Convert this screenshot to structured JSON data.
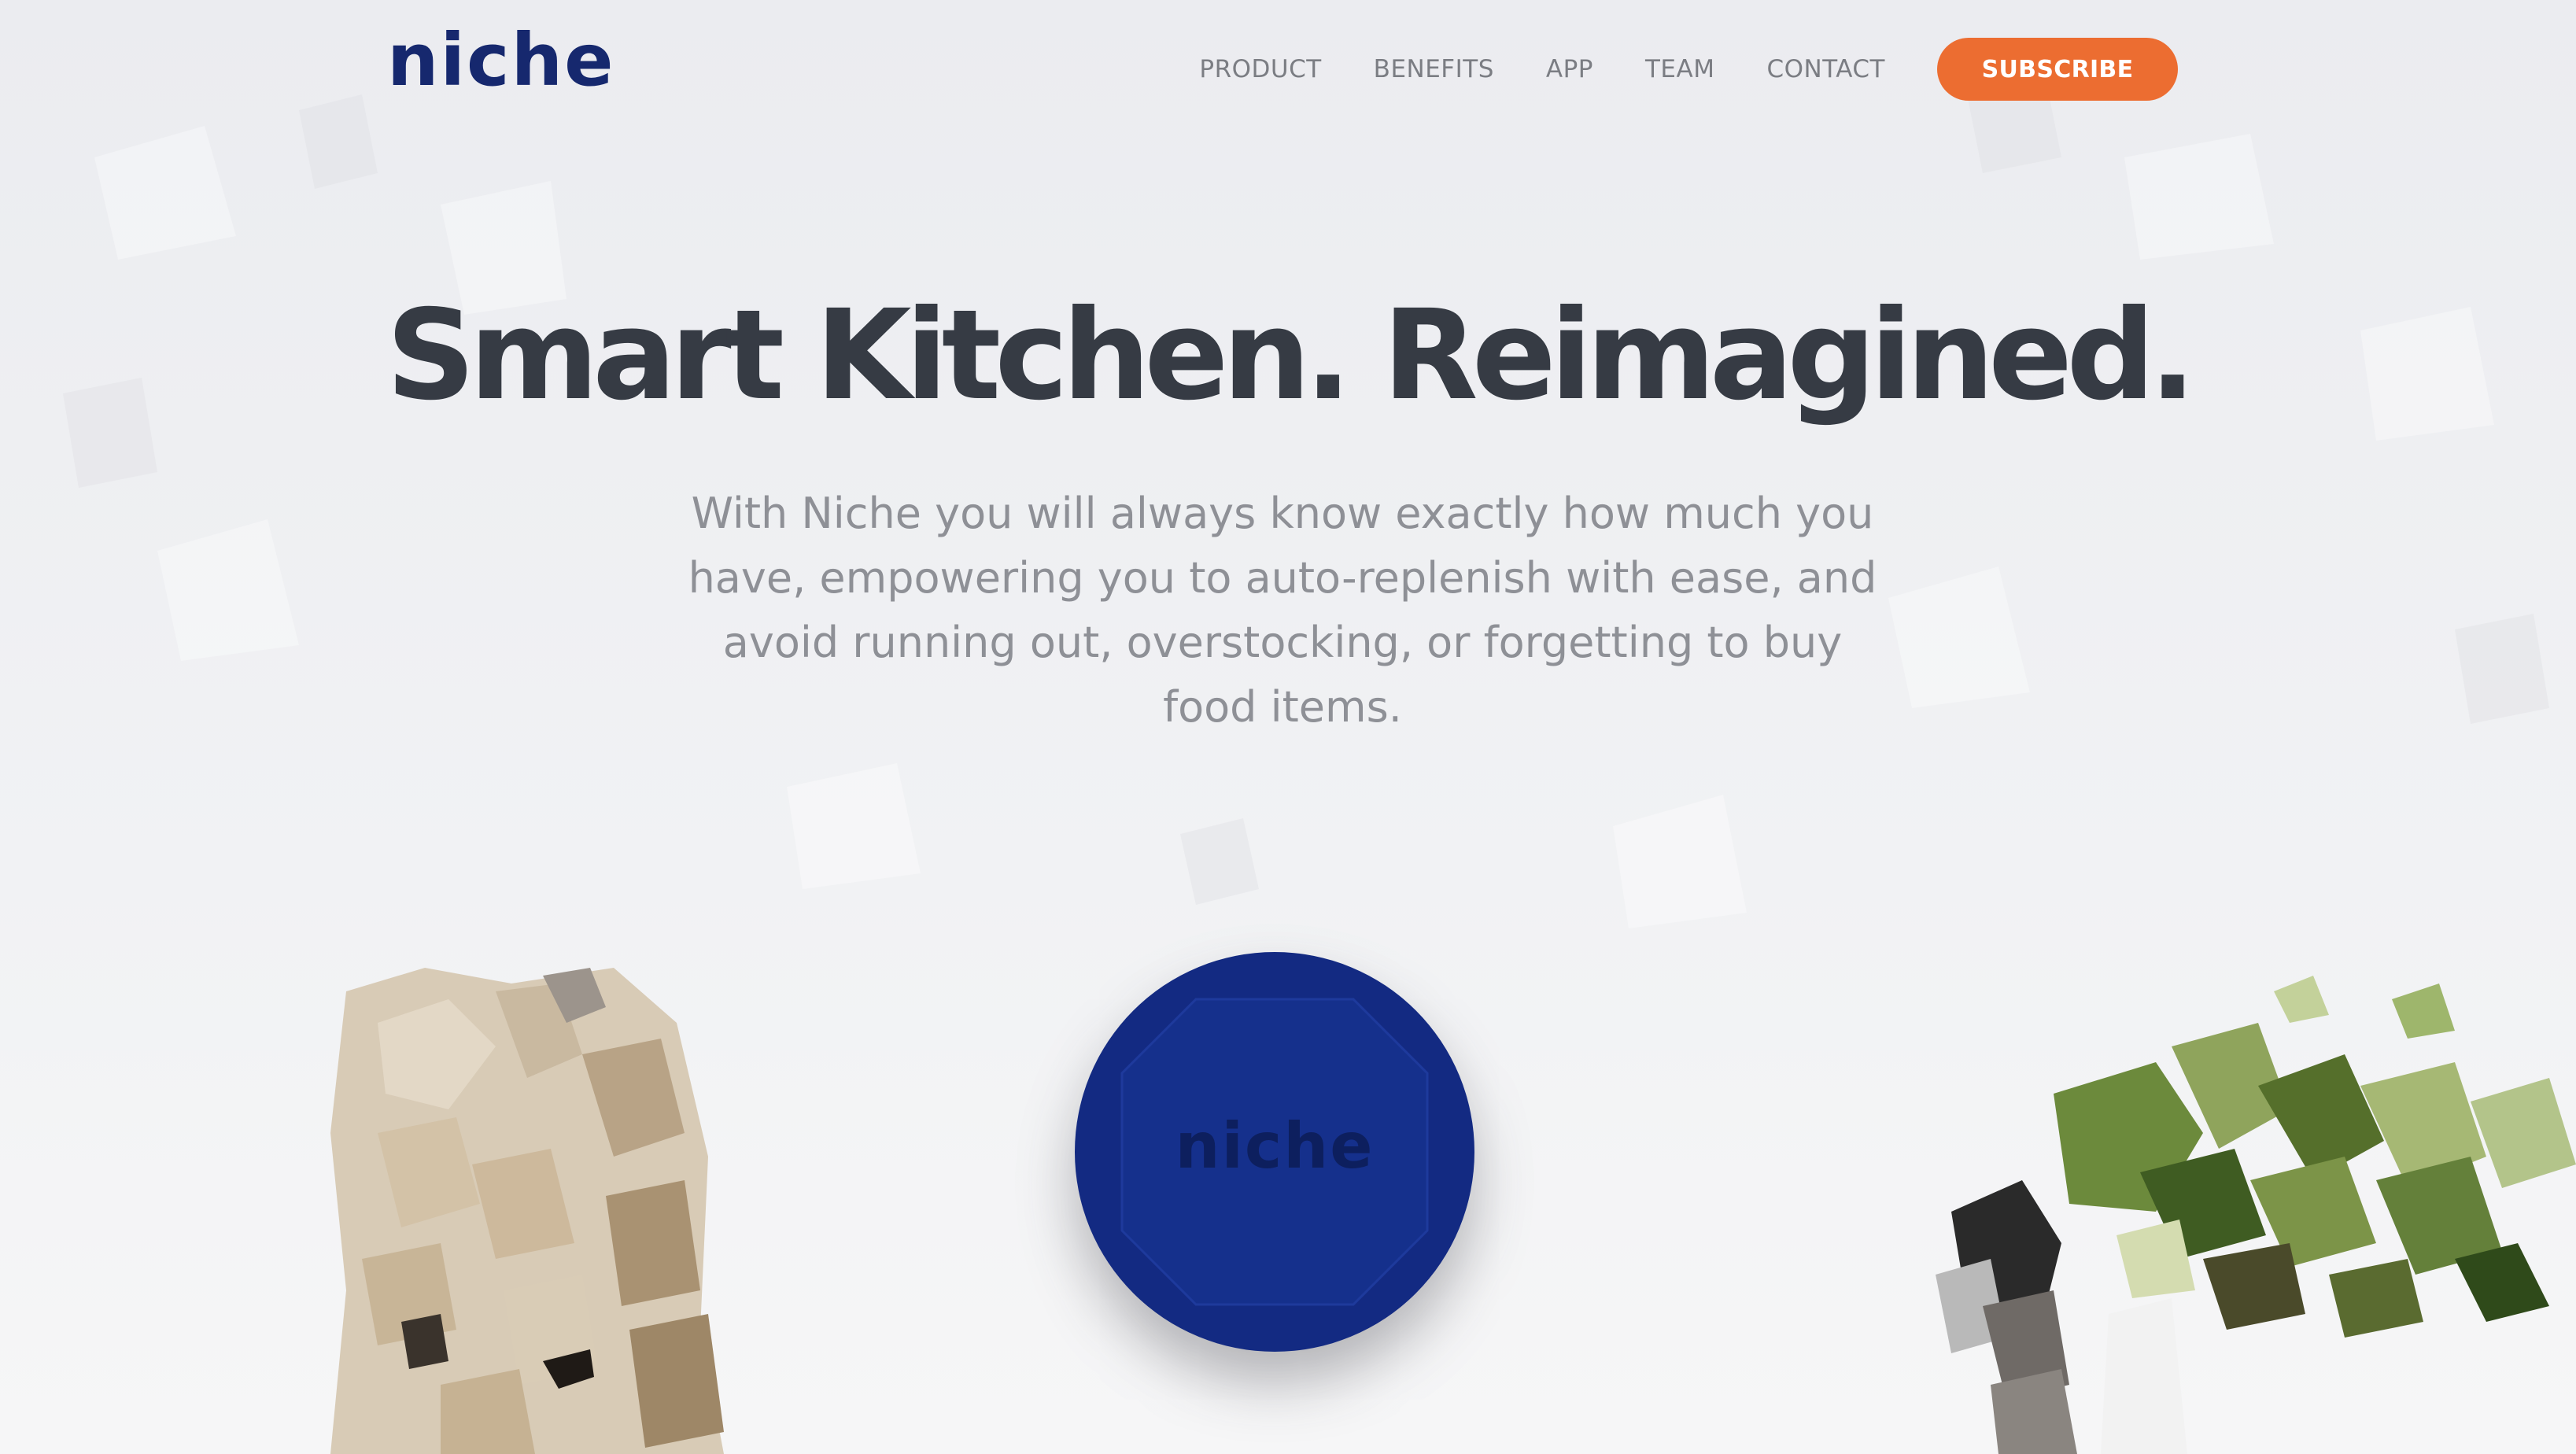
{
  "header": {
    "logo": "niche",
    "nav": [
      "PRODUCT",
      "BENEFITS",
      "APP",
      "TEAM",
      "CONTACT"
    ],
    "subscribe_label": "SUBSCRIBE"
  },
  "hero": {
    "title": "Smart Kitchen. Reimagined.",
    "subtitle": "With Niche you will always know exactly how much you have, empowering you to auto-replenish with ease, and avoid running out, overstocking, or forgetting to buy food items."
  },
  "device": {
    "label": "niche"
  },
  "colors": {
    "brand": "#16286e",
    "accent": "#ec6d31",
    "title": "#363b44",
    "subtitle": "#8e9096",
    "device": "#132a82"
  },
  "images": {
    "left": "mosaic-bag",
    "right": "mosaic-plant"
  }
}
